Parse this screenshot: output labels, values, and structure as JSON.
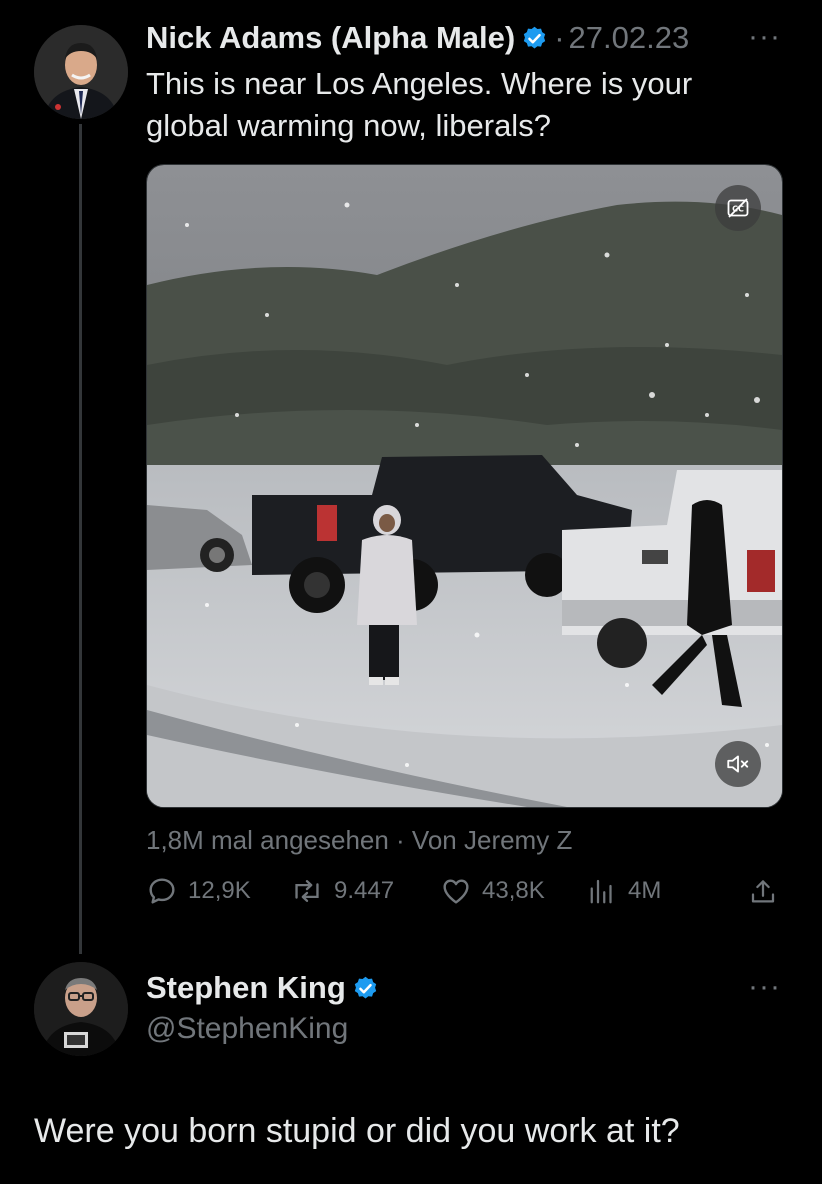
{
  "tweet": {
    "author_name": "Nick Adams (Alpha Male)",
    "separator": "·",
    "date": "27.02.23",
    "text_line1": "This is near Los Angeles. Where is your",
    "text_line2": "global warming now, liberals?",
    "views_text": "1,8M mal angesehen · Von Jeremy Z",
    "metrics": {
      "replies": "12,9K",
      "retweets": "9.447",
      "likes": "43,8K",
      "views": "4M"
    },
    "media": {
      "description": "video",
      "captions_icon": "cc-icon",
      "mute_icon": "speaker-muted-icon"
    }
  },
  "reply": {
    "author_name": "Stephen King",
    "handle": "@StephenKing",
    "text": "Were you born stupid or did you work at it?"
  },
  "colors": {
    "background": "#000000",
    "text_primary": "#e7e9ea",
    "text_secondary": "#71767b",
    "verified_blue": "#1d9bf0"
  },
  "more_label": "···"
}
